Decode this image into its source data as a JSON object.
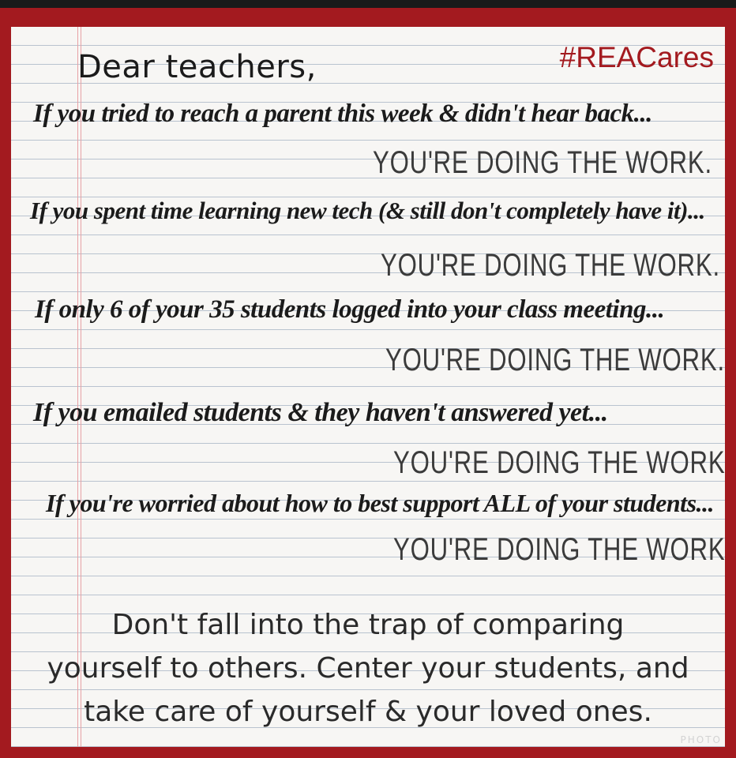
{
  "greeting": "Dear teachers,",
  "hashtag": "#REACares",
  "verses": [
    {
      "if_text": "If you tried to reach a parent this week & didn't hear back...",
      "work_text": "YOU'RE DOING THE WORK."
    },
    {
      "if_text": "If you spent time learning new tech (& still don't completely have it)...",
      "work_text": "YOU'RE DOING THE WORK."
    },
    {
      "if_text": "If only 6 of your 35 students logged into your class meeting...",
      "work_text": "YOU'RE DOING THE WORK."
    },
    {
      "if_text": "If you emailed students & they haven't answered yet...",
      "work_text": "YOU'RE DOING THE WORK."
    },
    {
      "if_text": "If you're worried about how to best support ALL of your students...",
      "work_text": "YOU'RE DOING THE WORK."
    }
  ],
  "closing": {
    "line1": "Don't fall into the trap of comparing",
    "line2": "yourself to others. Center your students, and",
    "line3": "take care of yourself & your loved ones."
  },
  "colors": {
    "frame": "#a31a1f",
    "paper": "#f7f6f4",
    "rule_line": "#b9c3cf",
    "hashtag": "#a31a1f"
  }
}
